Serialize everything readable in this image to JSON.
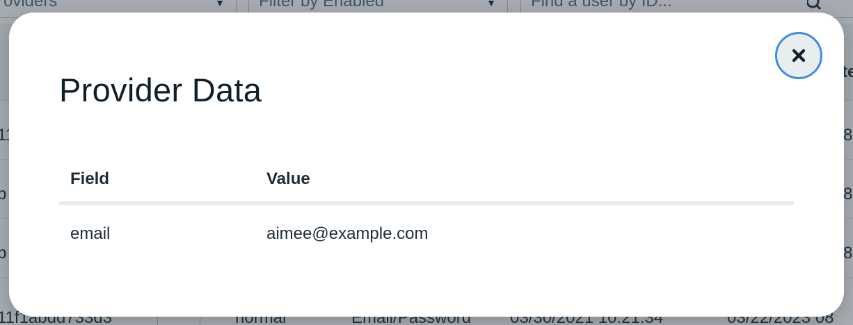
{
  "background": {
    "filters": [
      {
        "label": "oviders"
      },
      {
        "label": "Filter by Enabled"
      }
    ],
    "search": {
      "placeholder": "Find a user by ID..."
    },
    "header_right": "te",
    "rows": [
      {
        "id_fragment": "11",
        "date_fragment": "8"
      },
      {
        "id_fragment": "b",
        "date_fragment": "8"
      },
      {
        "id_fragment": "b",
        "date_fragment": "8"
      },
      {
        "id_fragment": "11f1abdd733d3",
        "type": "normal",
        "provider": "Email/Password",
        "created": "03/30/2021 10:21:34",
        "last_login": "03/22/2023 08"
      }
    ]
  },
  "modal": {
    "title": "Provider Data",
    "close_icon": "close-icon",
    "table": {
      "columns": [
        "Field",
        "Value"
      ],
      "rows": [
        {
          "field": "email",
          "value": "aimee@example.com"
        }
      ]
    }
  },
  "colors": {
    "focus_ring": "#3d8fe0",
    "title_text": "#0f1f2b",
    "body_text": "#1c2d38",
    "header_divider": "#e8ecee"
  }
}
